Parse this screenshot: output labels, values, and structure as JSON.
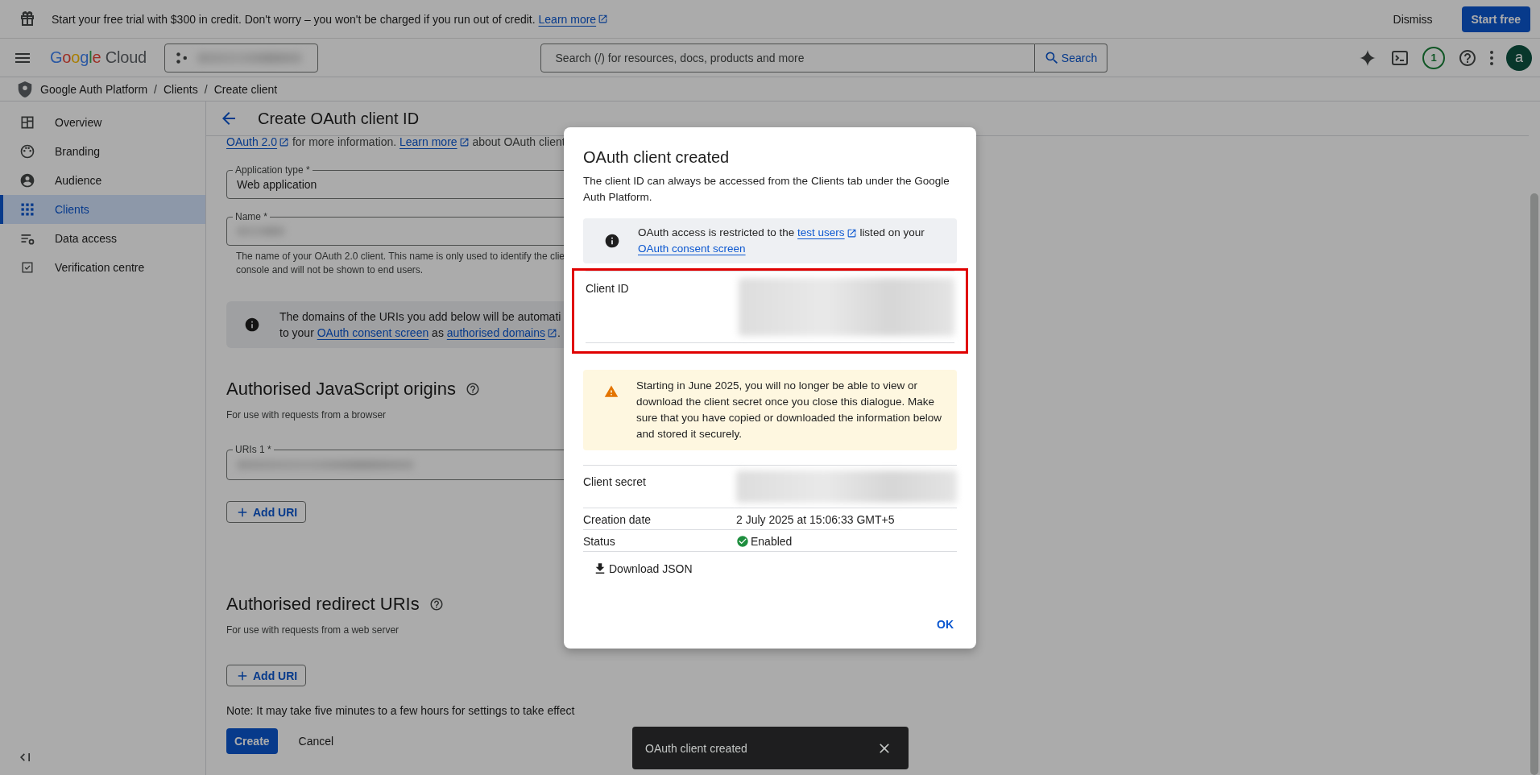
{
  "banner": {
    "message": "Start your free trial with $300 in credit. Don't worry – you won't be charged if you run out of credit.",
    "link": "Learn more",
    "dismiss": "Dismiss",
    "start": "Start free"
  },
  "header": {
    "logo": "Google Cloud",
    "search_placeholder": "Search (/) for resources, docs, products and more",
    "search_button": "Search",
    "notification_count": "1",
    "avatar": "a"
  },
  "breadcrumb": {
    "items": [
      "Google Auth Platform",
      "Clients",
      "Create client"
    ],
    "separator": "/"
  },
  "sidebar": {
    "items": [
      {
        "label": "Overview",
        "kind": "dashboard",
        "selected": false
      },
      {
        "label": "Branding",
        "kind": "palette",
        "selected": false
      },
      {
        "label": "Audience",
        "kind": "person",
        "selected": false
      },
      {
        "label": "Clients",
        "kind": "grid",
        "selected": true
      },
      {
        "label": "Data access",
        "kind": "data",
        "selected": false
      },
      {
        "label": "Verification centre",
        "kind": "check",
        "selected": false
      }
    ]
  },
  "page": {
    "title": "Create OAuth client ID",
    "intro": {
      "link1": "OAuth 2.0",
      "text1": " for more information. ",
      "link2": "Learn more",
      "text2": " about OAuth client"
    },
    "application_type": {
      "label": "Application type *",
      "value": "Web application"
    },
    "name_field": {
      "label": "Name *",
      "helper_1": "The name of your OAuth 2.0 client. This name is only used to identify the clie",
      "helper_2": "console and will not be shown to end users."
    },
    "info": {
      "line_1": "The domains of the URIs you add below will be automati",
      "text1": "to your ",
      "link1": "OAuth consent screen",
      "text2": " as ",
      "link2": "authorised domains",
      "text3": "."
    },
    "sections": [
      {
        "heading": "Authorised JavaScript origins",
        "subtitle": "For use with requests from a browser",
        "field_label": "URIs 1 *",
        "button": "Add URI"
      },
      {
        "heading": "Authorised redirect URIs",
        "subtitle": "For use with requests from a web server",
        "button": "Add URI"
      }
    ],
    "note": "Note: It may take five minutes to a few hours for settings to take effect",
    "create": "Create",
    "cancel": "Cancel"
  },
  "dialog": {
    "title": "OAuth client created",
    "description": "The client ID can always be accessed from the Clients tab under the Google Auth Platform.",
    "info": {
      "text1": "OAuth access is restricted to the ",
      "link1": "test users",
      "text2": " listed on your ",
      "link2": "OAuth consent screen"
    },
    "client_id": {
      "label": "Client ID",
      "highlighted": true
    },
    "warning": "Starting in June 2025, you will no longer be able to view or download the client secret once you close this dialogue. Make sure that you have copied or downloaded the information below and stored it securely.",
    "details": [
      {
        "label": "Client secret",
        "kind": "redacted"
      },
      {
        "label": "Creation date",
        "kind": "text",
        "value": "2 July 2025 at 15:06:33 GMT+5"
      },
      {
        "label": "Status",
        "kind": "status",
        "value": "Enabled"
      }
    ],
    "download": "Download JSON",
    "ok": "OK"
  },
  "snackbar": {
    "message": "OAuth client created"
  }
}
